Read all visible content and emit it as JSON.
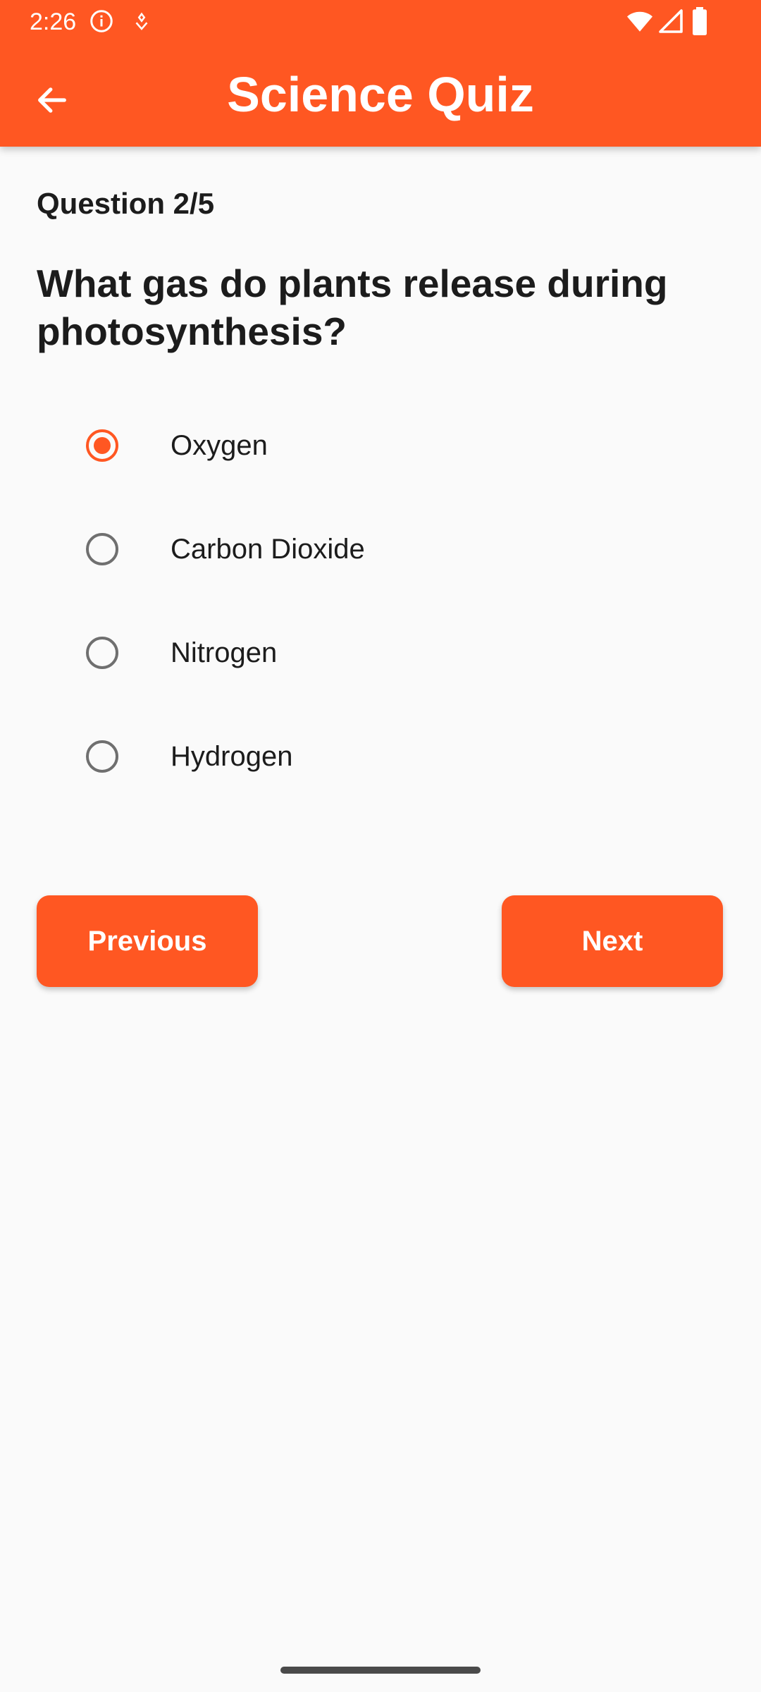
{
  "status_bar": {
    "time": "2:26",
    "icons": [
      "info-icon",
      "notification-icon",
      "wifi-icon",
      "signal-icon",
      "battery-icon"
    ]
  },
  "header": {
    "title": "Science Quiz",
    "back_icon": "arrow-left-icon"
  },
  "quiz": {
    "counter": "Question 2/5",
    "question": "What gas do plants release during photosynthesis?",
    "options": [
      {
        "label": "Oxygen",
        "selected": true
      },
      {
        "label": "Carbon Dioxide",
        "selected": false
      },
      {
        "label": "Nitrogen",
        "selected": false
      },
      {
        "label": "Hydrogen",
        "selected": false
      }
    ]
  },
  "buttons": {
    "previous": "Previous",
    "next": "Next"
  },
  "colors": {
    "accent": "#FF5722",
    "background": "#FAFAFA",
    "text": "#1C1C1C",
    "radio_unselected": "#6F6F6F"
  }
}
